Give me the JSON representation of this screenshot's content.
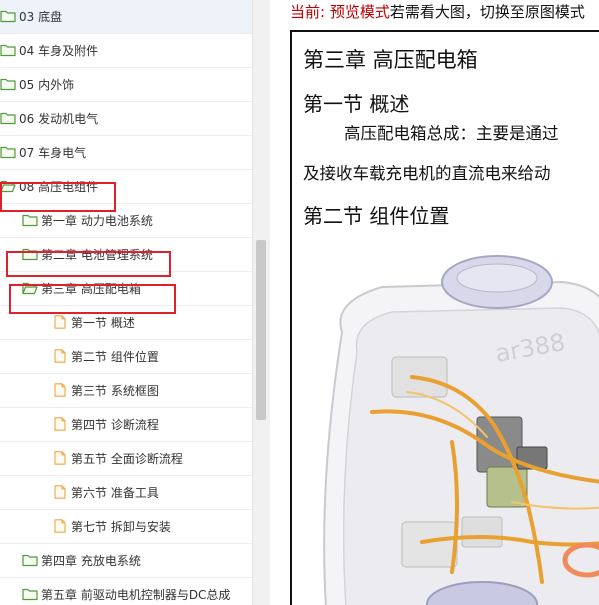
{
  "tree": {
    "items": [
      {
        "label": "03 底盘",
        "icon": "folder-icon",
        "level": 0
      },
      {
        "label": "04 车身及附件",
        "icon": "folder-icon",
        "level": 0
      },
      {
        "label": "05 内外饰",
        "icon": "folder-icon",
        "level": 0
      },
      {
        "label": "06 发动机电气",
        "icon": "folder-icon",
        "level": 0
      },
      {
        "label": "07 车身电气",
        "icon": "folder-icon",
        "level": 0
      },
      {
        "label": "08 高压电组件",
        "icon": "folder-open-icon",
        "level": 0
      },
      {
        "label": "第一章 动力电池系统",
        "icon": "folder-icon",
        "level": 1
      },
      {
        "label": "第二章 电池管理系统",
        "icon": "folder-icon",
        "level": 1
      },
      {
        "label": "第三章 高压配电箱",
        "icon": "folder-open-icon",
        "level": 1
      },
      {
        "label": "第一节 概述",
        "icon": "file-icon",
        "level": 2
      },
      {
        "label": "第二节 组件位置",
        "icon": "file-icon",
        "level": 2
      },
      {
        "label": "第三节 系统框图",
        "icon": "file-icon",
        "level": 2
      },
      {
        "label": "第四节 诊断流程",
        "icon": "file-icon",
        "level": 2
      },
      {
        "label": "第五节 全面诊断流程",
        "icon": "file-icon",
        "level": 2
      },
      {
        "label": "第六节 准备工具",
        "icon": "file-icon",
        "level": 2
      },
      {
        "label": "第七节 拆卸与安装",
        "icon": "file-icon",
        "level": 2
      },
      {
        "label": "第四章 充放电系统",
        "icon": "folder-icon",
        "level": 1
      },
      {
        "label": "第五章 前驱动电机控制器与DC总成",
        "icon": "folder-icon",
        "level": 1
      }
    ],
    "selected_index": 0
  },
  "notice": {
    "prefix": "当前: 预览模式",
    "suffix": "若需看大图，切换至原图模式"
  },
  "document": {
    "chapter_title": "第三章 高压配电箱",
    "section1_title": "第一节 概述",
    "para1": "高压配电箱总成：主要是通过",
    "para2": "及接收车载充电机的直流电来给动",
    "section2_title": "第二节 组件位置",
    "watermark": "ar388"
  },
  "colors": {
    "folder": "#4f9a3c",
    "folder_fill": "#f6fbf2",
    "file": "#f0a640",
    "highlight": "#e0202a",
    "notice_red": "#c00000",
    "harness": "#e8a030"
  }
}
